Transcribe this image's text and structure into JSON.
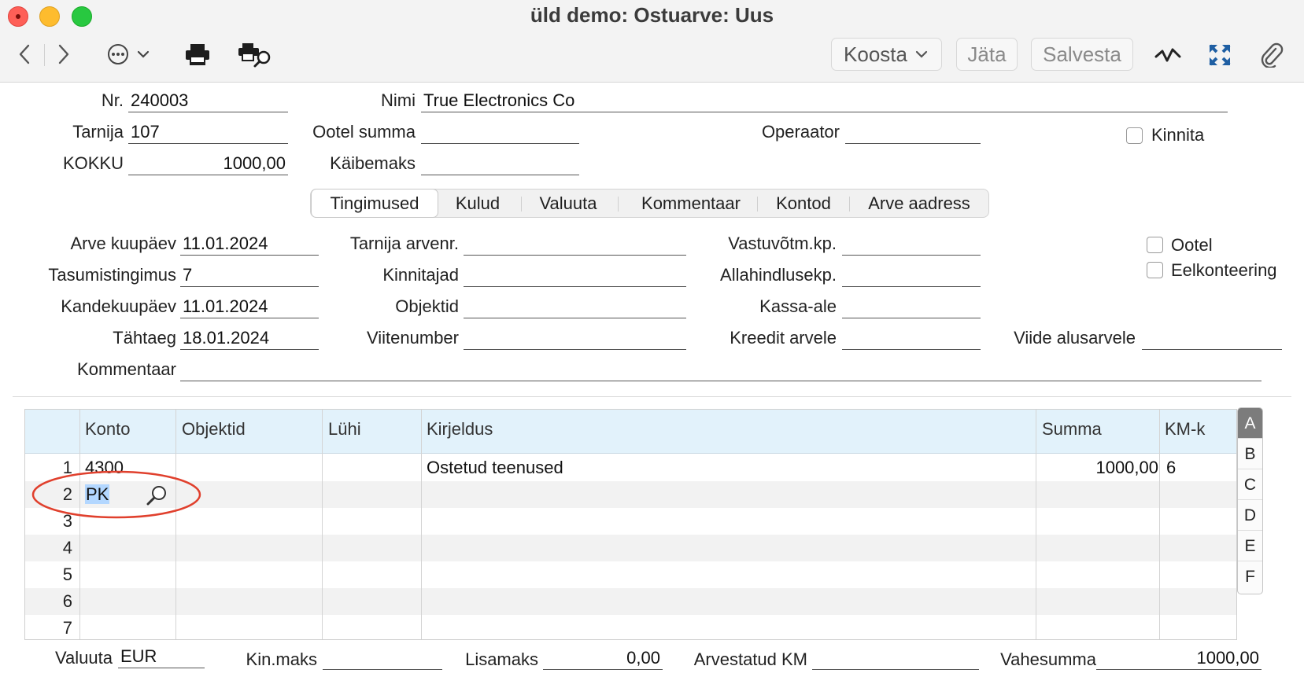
{
  "window": {
    "title": "üld demo: Ostuarve: Uus"
  },
  "toolbar": {
    "koosta": "Koosta",
    "jata": "Jäta",
    "salvesta": "Salvesta"
  },
  "header": {
    "nr_label": "Nr.",
    "nr": "240003",
    "nimi_label": "Nimi",
    "nimi": "True Electronics Co",
    "tarnija_label": "Tarnija",
    "tarnija": "107",
    "ootel_summa_label": "Ootel summa",
    "ootel_summa": "",
    "operaator_label": "Operaator",
    "operaator": "",
    "kinnita_label": "Kinnita",
    "kokku_label": "KOKKU",
    "kokku": "1000,00",
    "kaibemaks_label": "Käibemaks",
    "kaibemaks": ""
  },
  "tabs": [
    {
      "label": "Tingimused",
      "active": true
    },
    {
      "label": "Kulud"
    },
    {
      "label": "Valuuta"
    },
    {
      "label": "Kommentaar"
    },
    {
      "label": "Kontod"
    },
    {
      "label": "Arve aadress"
    }
  ],
  "terms": {
    "arve_kuupaev_label": "Arve kuupäev",
    "arve_kuupaev": "11.01.2024",
    "tasumistingimus_label": "Tasumistingimus",
    "tasumistingimus": "7",
    "kandekuupaev_label": "Kandekuupäev",
    "kandekuupaev": "11.01.2024",
    "tahtaeg_label": "Tähtaeg",
    "tahtaeg": "18.01.2024",
    "kommentaar_label": "Kommentaar",
    "kommentaar": "",
    "tarnija_arvenr_label": "Tarnija arvenr.",
    "tarnija_arvenr": "",
    "kinnitajad_label": "Kinnitajad",
    "kinnitajad": "",
    "objektid_label": "Objektid",
    "objektid": "",
    "viitenumber_label": "Viitenumber",
    "viitenumber": "",
    "vastuvotm_label": "Vastuvõtm.kp.",
    "vastuvotm": "",
    "allahindlus_label": "Allahindlusekp.",
    "allahindlus": "",
    "kassa_ale_label": "Kassa-ale",
    "kassa_ale": "",
    "kreedit_label": "Kreedit arvele",
    "kreedit": "",
    "ootel_label": "Ootel",
    "eelkonteering_label": "Eelkonteering",
    "viide_label": "Viide alusarvele",
    "viide": ""
  },
  "grid": {
    "columns": [
      "Konto",
      "Objektid",
      "Lühi",
      "Kirjeldus",
      "Summa",
      "KM-k"
    ],
    "rows": [
      {
        "n": "1",
        "konto": "4300",
        "kirjeldus": "Ostetud teenused",
        "summa": "1000,00",
        "kmk": "6"
      },
      {
        "n": "2",
        "konto": "PK",
        "kirjeldus": "",
        "summa": "",
        "kmk": ""
      },
      {
        "n": "3",
        "konto": "",
        "kirjeldus": "",
        "summa": "",
        "kmk": ""
      },
      {
        "n": "4",
        "konto": "",
        "kirjeldus": "",
        "summa": "",
        "kmk": ""
      },
      {
        "n": "5",
        "konto": "",
        "kirjeldus": "",
        "summa": "",
        "kmk": ""
      },
      {
        "n": "6",
        "konto": "",
        "kirjeldus": "",
        "summa": "",
        "kmk": ""
      },
      {
        "n": "7",
        "konto": "",
        "kirjeldus": "",
        "summa": "",
        "kmk": ""
      }
    ],
    "side_tabs": [
      "A",
      "B",
      "C",
      "D",
      "E",
      "F"
    ]
  },
  "footer": {
    "valuuta_label": "Valuuta",
    "valuuta": "EUR",
    "kinmaks_label": "Kin.maks",
    "kinmaks": "",
    "lisamaks_label": "Lisamaks",
    "lisamaks": "0,00",
    "arvestatud_km_label": "Arvestatud KM",
    "arvestatud_km": "",
    "vahesumma_label": "Vahesumma",
    "vahesumma": "1000,00"
  },
  "colors": {
    "grid_header": "#e2f2fb",
    "selection": "#b3d7ff",
    "annotation": "#e0402d"
  }
}
